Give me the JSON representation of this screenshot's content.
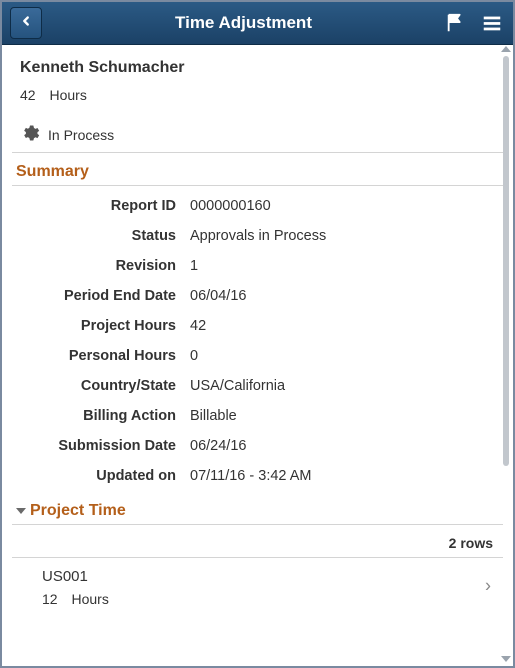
{
  "header": {
    "title": "Time Adjustment"
  },
  "person": {
    "name": "Kenneth Schumacher",
    "hours_value": "42",
    "hours_label": "Hours"
  },
  "processing": {
    "label": "In Process"
  },
  "summary": {
    "section_title": "Summary",
    "fields": {
      "report_id": {
        "label": "Report ID",
        "value": "0000000160"
      },
      "status": {
        "label": "Status",
        "value": "Approvals in Process"
      },
      "revision": {
        "label": "Revision",
        "value": "1"
      },
      "period_end": {
        "label": "Period End Date",
        "value": "06/04/16"
      },
      "project_hours": {
        "label": "Project Hours",
        "value": "42"
      },
      "personal_hours": {
        "label": "Personal Hours",
        "value": "0"
      },
      "country_state": {
        "label": "Country/State",
        "value": "USA/California"
      },
      "billing_action": {
        "label": "Billing Action",
        "value": "Billable"
      },
      "submission_date": {
        "label": "Submission Date",
        "value": "06/24/16"
      },
      "updated_on": {
        "label": "Updated on",
        "value": "07/11/16 - 3:42 AM"
      }
    }
  },
  "project_time": {
    "section_title": "Project Time",
    "row_count_label": "2 rows",
    "items": [
      {
        "code": "US001",
        "hours_value": "12",
        "hours_label": "Hours"
      }
    ]
  }
}
